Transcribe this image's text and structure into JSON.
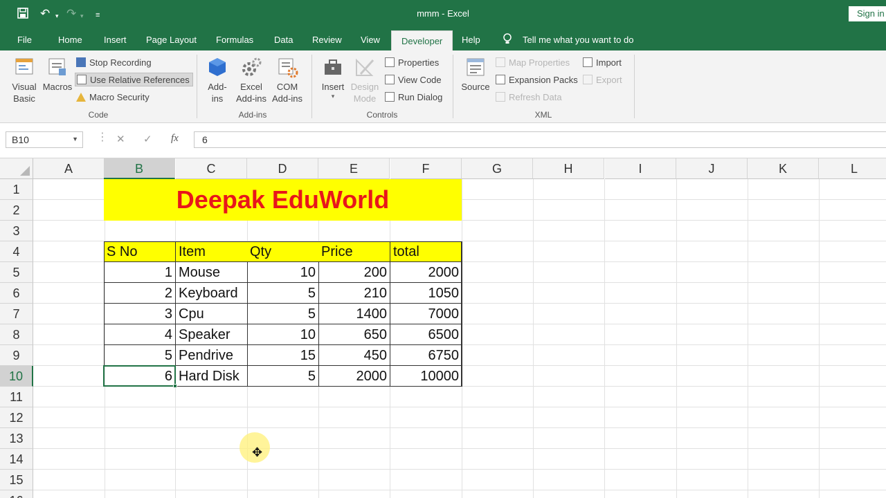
{
  "window": {
    "title": "mmm  -  Excel",
    "sign_in": "Sign in"
  },
  "quick_access": {
    "save_icon": "save-icon",
    "undo_icon": "undo-icon",
    "redo_icon": "redo-icon",
    "customize_icon": "customize-qat-icon"
  },
  "tabs": [
    {
      "label": "File"
    },
    {
      "label": "Home"
    },
    {
      "label": "Insert"
    },
    {
      "label": "Page Layout"
    },
    {
      "label": "Formulas"
    },
    {
      "label": "Data"
    },
    {
      "label": "Review"
    },
    {
      "label": "View"
    },
    {
      "label": "Developer",
      "active": true
    },
    {
      "label": "Help"
    }
  ],
  "tell_me": "Tell me what you want to do",
  "ribbon": {
    "code": {
      "group_label": "Code",
      "visual_basic": "Visual Basic",
      "macros": "Macros",
      "stop_recording": "Stop Recording",
      "use_relative_references": "Use Relative References",
      "macro_security": "Macro Security"
    },
    "addins": {
      "group_label": "Add-ins",
      "addins": "Add-ins",
      "excel_addins": "Excel Add-ins",
      "com_addins": "COM Add-ins"
    },
    "controls": {
      "group_label": "Controls",
      "insert": "Insert",
      "design_mode": "Design Mode",
      "properties": "Properties",
      "view_code": "View Code",
      "run_dialog": "Run Dialog"
    },
    "xml": {
      "group_label": "XML",
      "source": "Source",
      "map_properties": "Map Properties",
      "expansion_packs": "Expansion Packs",
      "refresh_data": "Refresh Data",
      "import": "Import",
      "export": "Export"
    }
  },
  "formula_bar": {
    "name_box": "B10",
    "formula": "6",
    "cancel_glyph": "✕",
    "enter_glyph": "✓",
    "fx_glyph": "fx"
  },
  "sheet": {
    "columns": [
      "A",
      "B",
      "C",
      "D",
      "E",
      "F",
      "G",
      "H",
      "I",
      "J",
      "K",
      "L"
    ],
    "rows": [
      "1",
      "2",
      "3",
      "4",
      "5",
      "6",
      "7",
      "8",
      "9",
      "10",
      "11",
      "12",
      "13",
      "14",
      "15",
      "16"
    ],
    "selected_column": "B",
    "selected_row": "10",
    "banner": "Deepak EduWorld",
    "table": {
      "headers": [
        "S No",
        "Item",
        "Qty",
        "Price",
        "total"
      ],
      "rows": [
        [
          "1",
          "Mouse",
          "10",
          "200",
          "2000"
        ],
        [
          "2",
          "Keyboard",
          "5",
          "210",
          "1050"
        ],
        [
          "3",
          "Cpu",
          "5",
          "1400",
          "7000"
        ],
        [
          "4",
          "Speaker",
          "10",
          "650",
          "6500"
        ],
        [
          "5",
          "Pendrive",
          "15",
          "450",
          "6750"
        ],
        [
          "6",
          "Hard Disk",
          "5",
          "2000",
          "10000"
        ]
      ]
    }
  },
  "colors": {
    "excel_green": "#217346",
    "banner_fill": "#ffff00",
    "banner_text": "#e8161b"
  }
}
